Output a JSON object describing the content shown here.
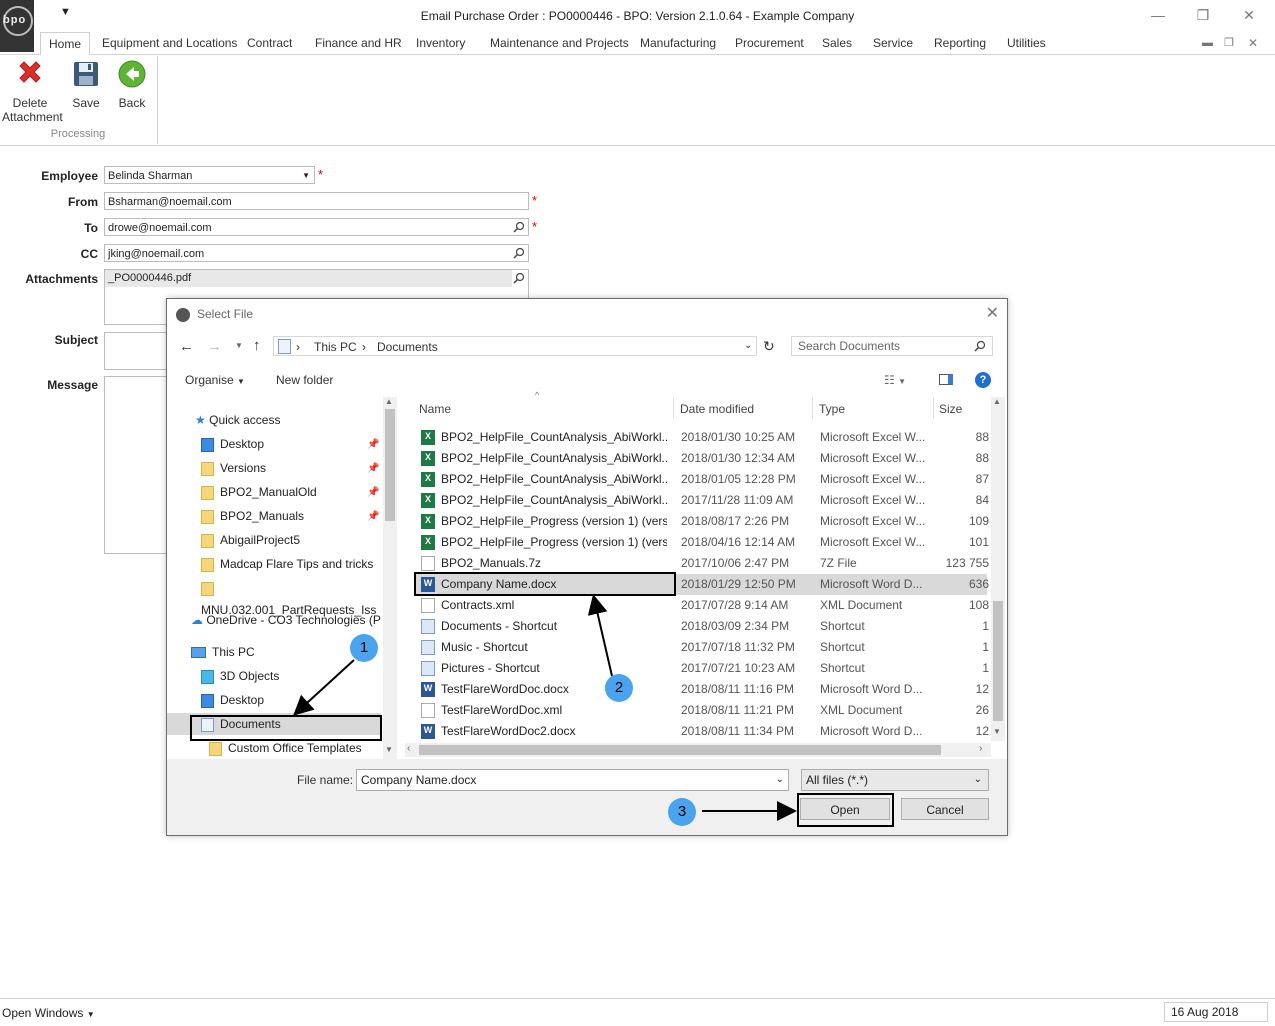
{
  "window": {
    "title": "Email Purchase Order : PO0000446 - BPO: Version 2.1.0.64 - Example Company",
    "logo_text": "bpo"
  },
  "menu_tabs": [
    "Home",
    "Equipment and Locations",
    "Contract",
    "Finance and HR",
    "Inventory",
    "Maintenance and Projects",
    "Manufacturing",
    "Procurement",
    "Sales",
    "Service",
    "Reporting",
    "Utilities"
  ],
  "ribbon": {
    "delete_label_1": "Delete",
    "delete_label_2": "Attachment",
    "save_label": "Save",
    "back_label": "Back",
    "group_label": "Processing"
  },
  "form": {
    "employee_label": "Employee",
    "employee_value": "Belinda Sharman",
    "from_label": "From",
    "from_value": "Bsharman@noemail.com",
    "to_label": "To",
    "to_value": "drowe@noemail.com",
    "cc_label": "CC",
    "cc_value": "jking@noemail.com",
    "attachments_label": "Attachments",
    "attachments_value": "_PO0000446.pdf",
    "subject_label": "Subject",
    "message_label": "Message",
    "required_mark": "*"
  },
  "dialog": {
    "title": "Select File",
    "path_1": "This PC",
    "path_2": "Documents",
    "search_placeholder": "Search Documents",
    "organise_label": "Organise",
    "new_folder_label": "New folder",
    "help_label": "?",
    "columns": {
      "name": "Name",
      "date": "Date modified",
      "type": "Type",
      "size": "Size"
    },
    "tree": [
      {
        "label": "Quick access",
        "kind": "star"
      },
      {
        "label": "Desktop",
        "kind": "desktop",
        "pinned": true
      },
      {
        "label": "Versions",
        "kind": "folder",
        "pinned": true
      },
      {
        "label": "BPO2_ManualOld",
        "kind": "folder",
        "pinned": true
      },
      {
        "label": "BPO2_Manuals",
        "kind": "folder",
        "pinned": true
      },
      {
        "label": "AbigailProject5",
        "kind": "folder"
      },
      {
        "label": "Madcap Flare Tips and tricks",
        "kind": "folder"
      },
      {
        "label": "MNU.032.001_PartRequests_Iss",
        "kind": "folder"
      },
      {
        "label": "OneDrive - CO3 Technologies (P",
        "kind": "cloud"
      },
      {
        "label": "This PC",
        "kind": "pc"
      },
      {
        "label": "3D Objects",
        "kind": "cube"
      },
      {
        "label": "Desktop",
        "kind": "desktop"
      },
      {
        "label": "Documents",
        "kind": "docs",
        "selected": true
      },
      {
        "label": "Custom Office Templates",
        "kind": "folder"
      }
    ],
    "files": [
      {
        "name": "BPO2_HelpFile_CountAnalysis_AbiWorkl...",
        "date": "2018/01/30 10:25 AM",
        "type": "Microsoft Excel W...",
        "size": "88",
        "icon": "x"
      },
      {
        "name": "BPO2_HelpFile_CountAnalysis_AbiWorkl...",
        "date": "2018/01/30 12:34 AM",
        "type": "Microsoft Excel W...",
        "size": "88",
        "icon": "x"
      },
      {
        "name": "BPO2_HelpFile_CountAnalysis_AbiWorkl...",
        "date": "2018/01/05 12:28 PM",
        "type": "Microsoft Excel W...",
        "size": "87",
        "icon": "x"
      },
      {
        "name": "BPO2_HelpFile_CountAnalysis_AbiWorkl...",
        "date": "2017/11/28 11:09 AM",
        "type": "Microsoft Excel W...",
        "size": "84",
        "icon": "x"
      },
      {
        "name": "BPO2_HelpFile_Progress (version 1) (versi...",
        "date": "2018/08/17 2:26 PM",
        "type": "Microsoft Excel W...",
        "size": "109",
        "icon": "x"
      },
      {
        "name": "BPO2_HelpFile_Progress (version 1) (versi...",
        "date": "2018/04/16 12:14 AM",
        "type": "Microsoft Excel W...",
        "size": "101",
        "icon": "x"
      },
      {
        "name": "BPO2_Manuals.7z",
        "date": "2017/10/06 2:47 PM",
        "type": "7Z File",
        "size": "123 755",
        "icon": "g"
      },
      {
        "name": "Company Name.docx",
        "date": "2018/01/29 12:50 PM",
        "type": "Microsoft Word D...",
        "size": "636",
        "icon": "w",
        "selected": true
      },
      {
        "name": "Contracts.xml",
        "date": "2017/07/28 9:14 AM",
        "type": "XML Document",
        "size": "108",
        "icon": "g"
      },
      {
        "name": "Documents - Shortcut",
        "date": "2018/03/09 2:34 PM",
        "type": "Shortcut",
        "size": "1",
        "icon": "s"
      },
      {
        "name": "Music - Shortcut",
        "date": "2017/07/18 11:32 PM",
        "type": "Shortcut",
        "size": "1",
        "icon": "s"
      },
      {
        "name": "Pictures - Shortcut",
        "date": "2017/07/21 10:23 AM",
        "type": "Shortcut",
        "size": "1",
        "icon": "s"
      },
      {
        "name": "TestFlareWordDoc.docx",
        "date": "2018/08/11 11:16 PM",
        "type": "Microsoft Word D...",
        "size": "12",
        "icon": "w"
      },
      {
        "name": "TestFlareWordDoc.xml",
        "date": "2018/08/11 11:21 PM",
        "type": "XML Document",
        "size": "26",
        "icon": "g"
      },
      {
        "name": "TestFlareWordDoc2.docx",
        "date": "2018/08/11 11:34 PM",
        "type": "Microsoft Word D...",
        "size": "12",
        "icon": "w"
      }
    ],
    "filename_label": "File name:",
    "filename_value": "Company Name.docx",
    "filter_value": "All files (*.*)",
    "open_label": "Open",
    "cancel_label": "Cancel"
  },
  "callouts": [
    "1",
    "2",
    "3"
  ],
  "status": {
    "open_windows_label": "Open Windows",
    "date": "16 Aug 2018"
  },
  "colors": {
    "accent_blue": "#4aa3ef",
    "required_red": "#dd0000",
    "back_green": "#5fb336",
    "delete_red": "#d9302c"
  }
}
